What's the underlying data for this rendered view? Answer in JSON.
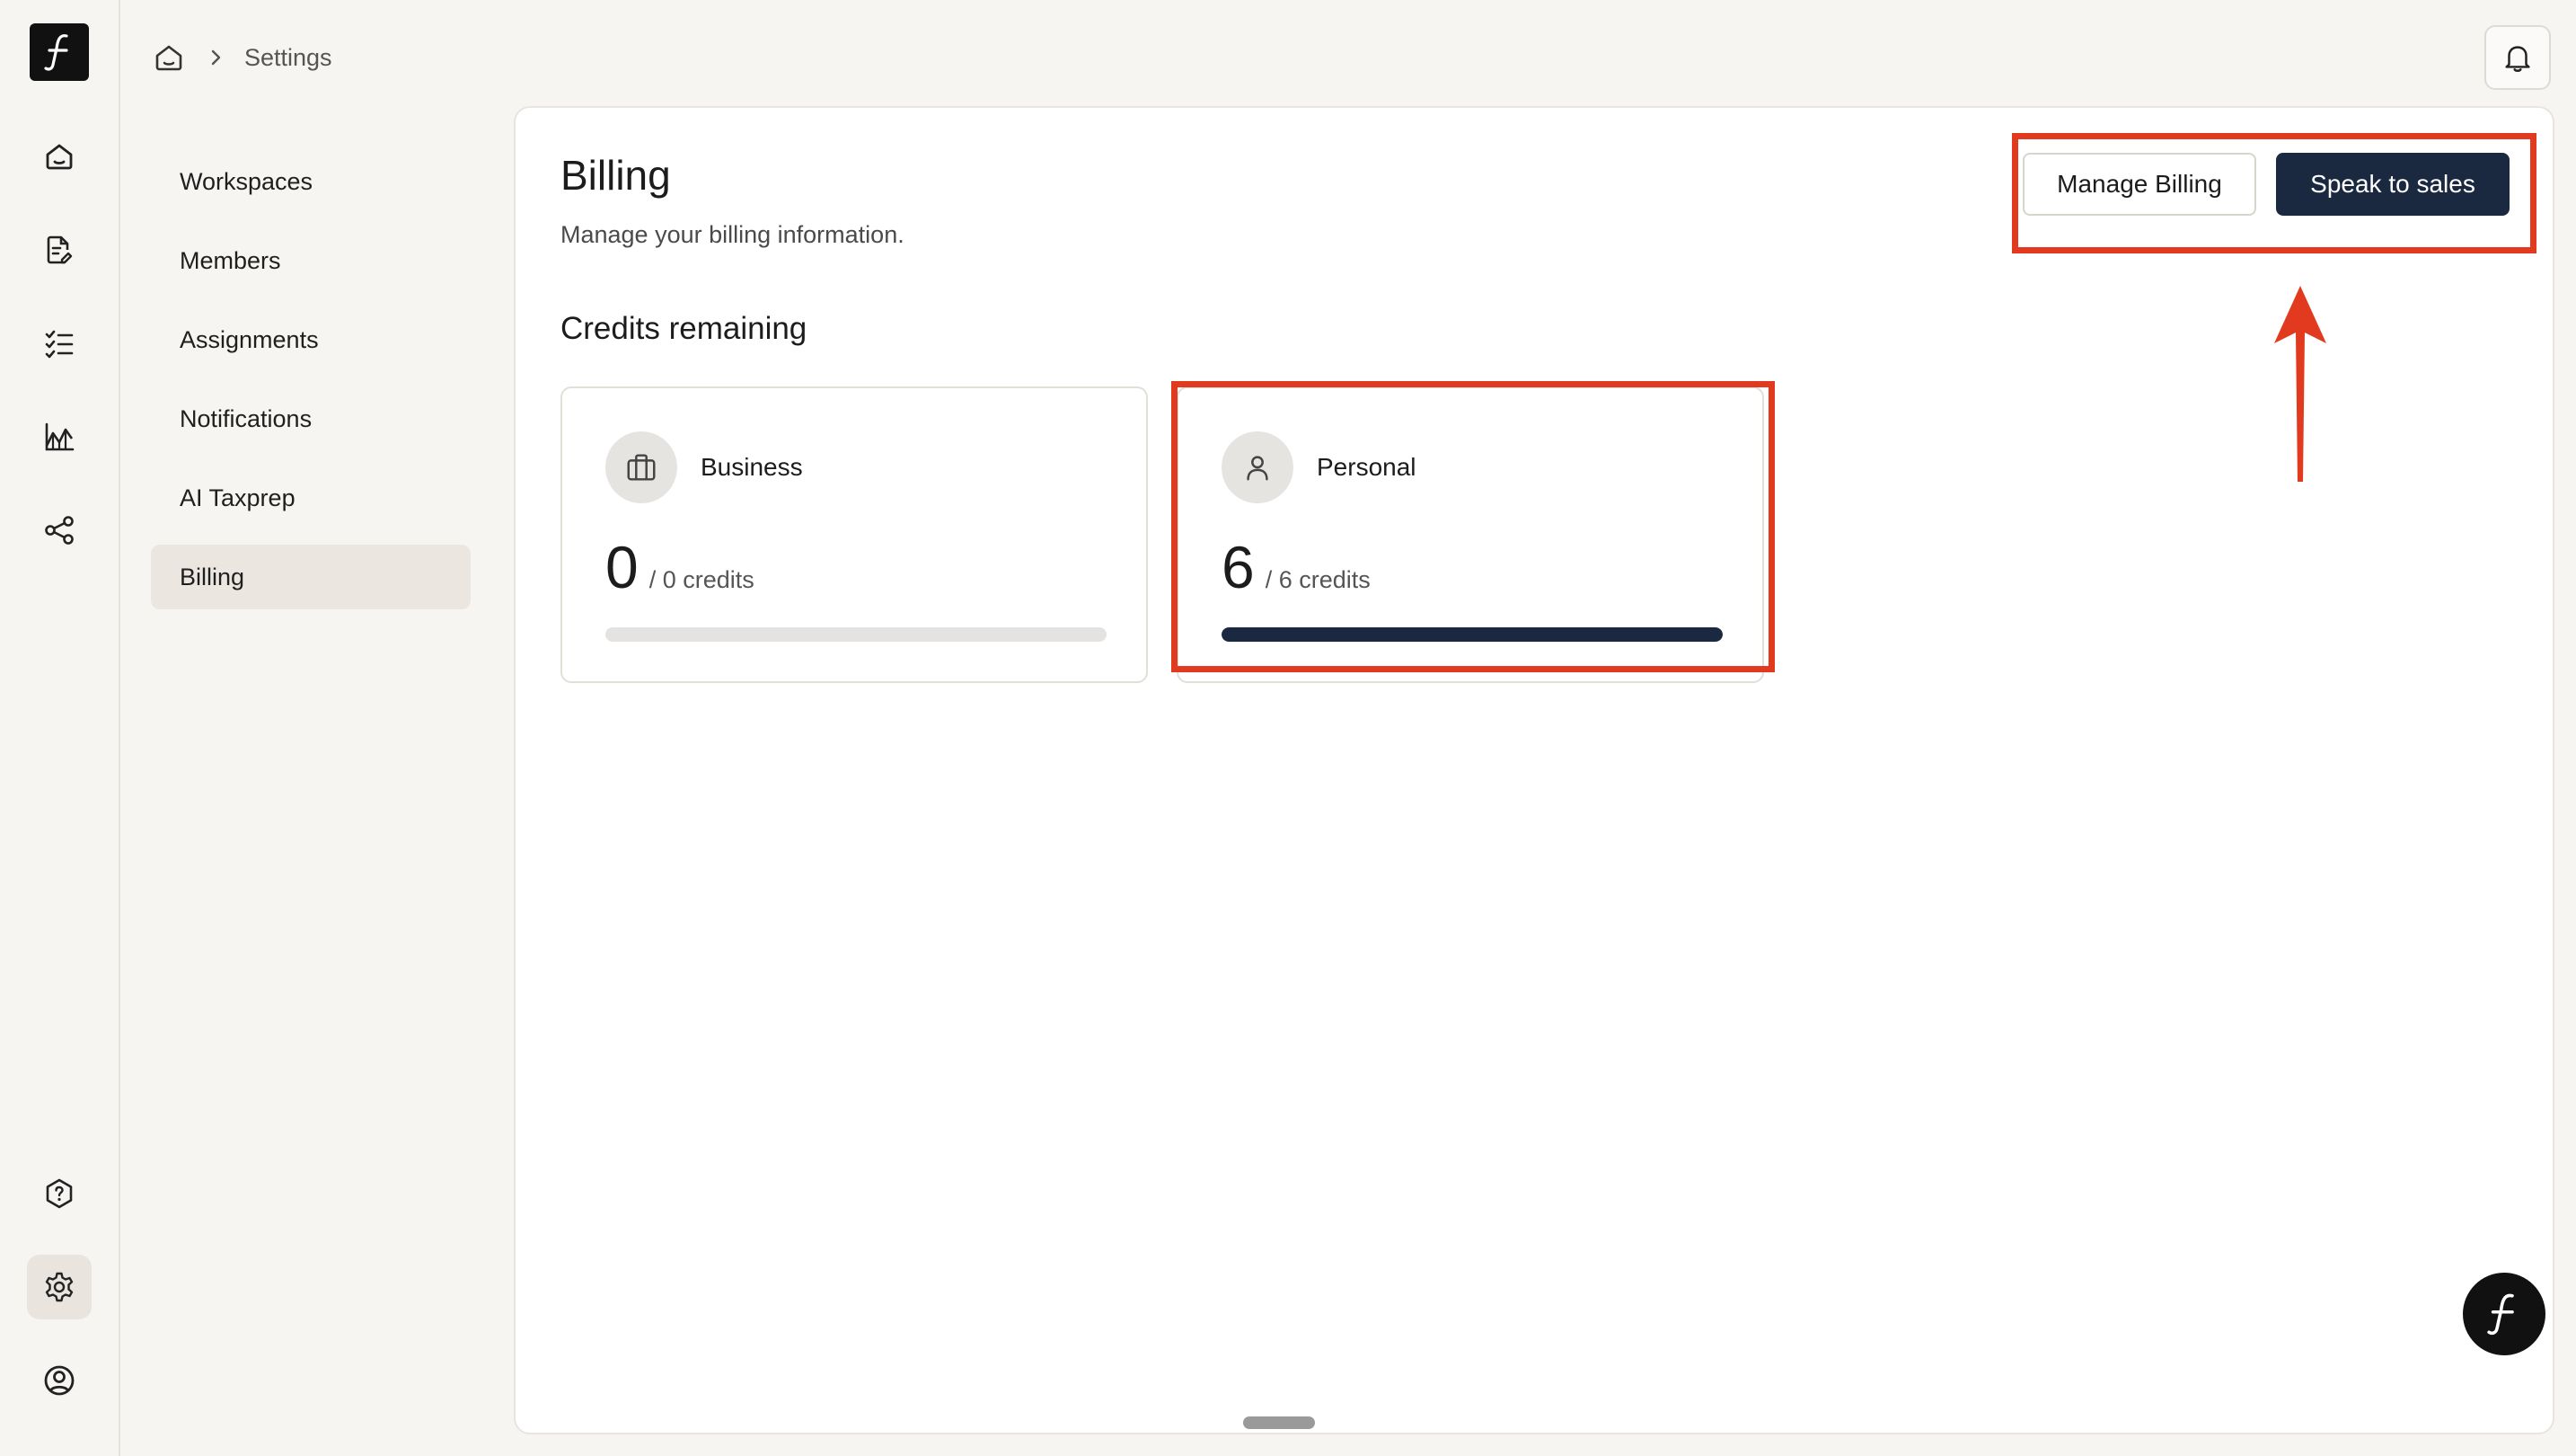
{
  "breadcrumb": {
    "current": "Settings"
  },
  "rail": {
    "top_icons": [
      "home-icon",
      "document-edit-icon",
      "checklist-icon",
      "analytics-icon",
      "share-icon"
    ],
    "bottom_icons": [
      "help-icon",
      "settings-icon",
      "account-icon"
    ],
    "active": "settings-icon"
  },
  "settings_nav": {
    "items": [
      {
        "label": "Workspaces"
      },
      {
        "label": "Members"
      },
      {
        "label": "Assignments"
      },
      {
        "label": "Notifications"
      },
      {
        "label": "AI Taxprep"
      },
      {
        "label": "Billing"
      }
    ],
    "active": "Billing"
  },
  "billing": {
    "title": "Billing",
    "subtitle": "Manage your billing information.",
    "manage_label": "Manage Billing",
    "sales_label": "Speak to sales",
    "credits_title": "Credits remaining",
    "cards": [
      {
        "name": "Business",
        "count": "0",
        "credits": "/ 0 credits",
        "fill_fraction": 0
      },
      {
        "name": "Personal",
        "count": "6",
        "credits": "/ 6 credits",
        "fill_fraction": 1
      }
    ]
  },
  "colors": {
    "primary": "#1b2940",
    "annotation": "#e23a1e",
    "background": "#f6f5f2"
  }
}
